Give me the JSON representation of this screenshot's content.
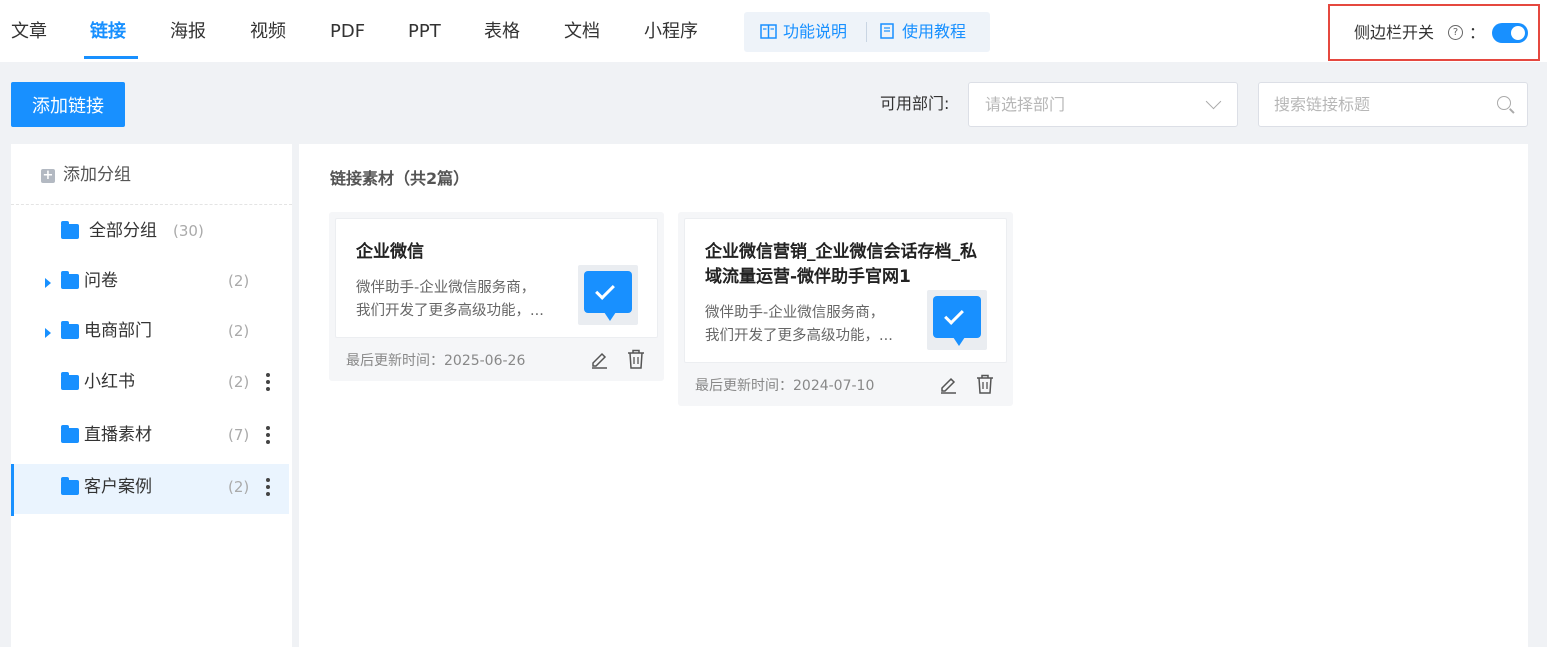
{
  "tabs": [
    {
      "label": "文章",
      "active": false
    },
    {
      "label": "链接",
      "active": true
    },
    {
      "label": "海报",
      "active": false
    },
    {
      "label": "视频",
      "active": false
    },
    {
      "label": "PDF",
      "active": false
    },
    {
      "label": "PPT",
      "active": false
    },
    {
      "label": "表格",
      "active": false
    },
    {
      "label": "文档",
      "active": false
    },
    {
      "label": "小程序",
      "active": false
    }
  ],
  "help": {
    "feature_label": "功能说明",
    "tutorial_label": "使用教程"
  },
  "sidebar_toggle": {
    "label": "侧边栏开关",
    "colon": "：",
    "on": true
  },
  "toolbar": {
    "add_link_label": "添加链接",
    "dept_label": "可用部门:",
    "dept_placeholder": "请选择部门",
    "search_placeholder": "搜索链接标题"
  },
  "sidebar": {
    "add_group_label": "添加分组",
    "groups": [
      {
        "name": "全部分组",
        "count": "(30)",
        "expandable": false,
        "has_menu": false,
        "selected": false
      },
      {
        "name": "问卷",
        "count": "(2)",
        "expandable": true,
        "has_menu": false,
        "selected": false
      },
      {
        "name": "电商部门",
        "count": "(2)",
        "expandable": true,
        "has_menu": false,
        "selected": false
      },
      {
        "name": "小红书",
        "count": "(2)",
        "expandable": false,
        "has_menu": true,
        "selected": false
      },
      {
        "name": "直播素材",
        "count": "(7)",
        "expandable": false,
        "has_menu": true,
        "selected": false
      },
      {
        "name": "客户案例",
        "count": "(2)",
        "expandable": false,
        "has_menu": true,
        "selected": true
      }
    ]
  },
  "main": {
    "section_title": "链接素材（共2篇）",
    "cards": [
      {
        "title": "企业微信",
        "desc_line1": "微伴助手-企业微信服务商，",
        "desc_line2": "我们开发了更多高级功能，...",
        "updated": "最后更新时间：2025-06-26"
      },
      {
        "title": "企业微信营销_企业微信会话存档_私域流量运营-微伴助手官网1",
        "desc_line1": "微伴助手-企业微信服务商，",
        "desc_line2": "我们开发了更多高级功能，...",
        "updated": "最后更新时间：2024-07-10"
      }
    ]
  },
  "colors": {
    "accent": "#1890ff",
    "highlight_border": "#e5483f"
  }
}
